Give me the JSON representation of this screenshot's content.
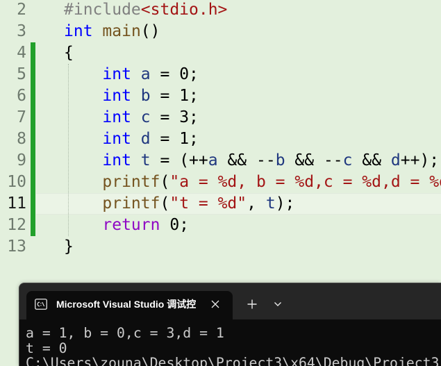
{
  "editor": {
    "lines": [
      {
        "number": "2",
        "tokens": [
          {
            "text": "#include",
            "color": "#808080"
          },
          {
            "text": "<stdio.h>",
            "color": "#a31515"
          }
        ]
      },
      {
        "number": "3",
        "tokens": [
          {
            "text": "int",
            "color": "#0000ff"
          },
          {
            "text": " ",
            "color": "#000000"
          },
          {
            "text": "main",
            "color": "#74531f"
          },
          {
            "text": "()",
            "color": "#000000"
          }
        ]
      },
      {
        "number": "4",
        "tokens": [
          {
            "text": "{",
            "color": "#000000"
          }
        ]
      },
      {
        "number": "5",
        "tokens": [
          {
            "text": "    ",
            "color": "#000000"
          },
          {
            "text": "int",
            "color": "#0000ff"
          },
          {
            "text": " ",
            "color": "#000000"
          },
          {
            "text": "a",
            "color": "#1f377f"
          },
          {
            "text": " = 0;",
            "color": "#000000"
          }
        ]
      },
      {
        "number": "6",
        "tokens": [
          {
            "text": "    ",
            "color": "#000000"
          },
          {
            "text": "int",
            "color": "#0000ff"
          },
          {
            "text": " ",
            "color": "#000000"
          },
          {
            "text": "b",
            "color": "#1f377f"
          },
          {
            "text": " = 1;",
            "color": "#000000"
          }
        ]
      },
      {
        "number": "7",
        "tokens": [
          {
            "text": "    ",
            "color": "#000000"
          },
          {
            "text": "int",
            "color": "#0000ff"
          },
          {
            "text": " ",
            "color": "#000000"
          },
          {
            "text": "c",
            "color": "#1f377f"
          },
          {
            "text": " = 3;",
            "color": "#000000"
          }
        ]
      },
      {
        "number": "8",
        "tokens": [
          {
            "text": "    ",
            "color": "#000000"
          },
          {
            "text": "int",
            "color": "#0000ff"
          },
          {
            "text": " ",
            "color": "#000000"
          },
          {
            "text": "d",
            "color": "#1f377f"
          },
          {
            "text": " = 1;",
            "color": "#000000"
          }
        ]
      },
      {
        "number": "9",
        "tokens": [
          {
            "text": "    ",
            "color": "#000000"
          },
          {
            "text": "int",
            "color": "#0000ff"
          },
          {
            "text": " ",
            "color": "#000000"
          },
          {
            "text": "t",
            "color": "#1f377f"
          },
          {
            "text": " = (++",
            "color": "#000000"
          },
          {
            "text": "a",
            "color": "#1f377f"
          },
          {
            "text": " && --",
            "color": "#000000"
          },
          {
            "text": "b",
            "color": "#1f377f"
          },
          {
            "text": " && --",
            "color": "#000000"
          },
          {
            "text": "c",
            "color": "#1f377f"
          },
          {
            "text": " && ",
            "color": "#000000"
          },
          {
            "text": "d",
            "color": "#1f377f"
          },
          {
            "text": "++);",
            "color": "#000000"
          }
        ]
      },
      {
        "number": "10",
        "tokens": [
          {
            "text": "    ",
            "color": "#000000"
          },
          {
            "text": "printf",
            "color": "#74531f"
          },
          {
            "text": "(",
            "color": "#000000"
          },
          {
            "text": "\"a = %d, b = %d,c = %d,d = %d",
            "color": "#a31515"
          }
        ]
      },
      {
        "number": "11",
        "current": true,
        "tokens": [
          {
            "text": "    ",
            "color": "#000000"
          },
          {
            "text": "printf",
            "color": "#74531f"
          },
          {
            "text": "(",
            "color": "#000000"
          },
          {
            "text": "\"t = %d\"",
            "color": "#a31515"
          },
          {
            "text": ", ",
            "color": "#000000"
          },
          {
            "text": "t",
            "color": "#1f377f"
          },
          {
            "text": ");",
            "color": "#000000"
          }
        ]
      },
      {
        "number": "12",
        "tokens": [
          {
            "text": "    ",
            "color": "#000000"
          },
          {
            "text": "return",
            "color": "#8f08c4"
          },
          {
            "text": " 0;",
            "color": "#000000"
          }
        ]
      },
      {
        "number": "13",
        "tokens": [
          {
            "text": "}",
            "color": "#000000"
          }
        ]
      }
    ]
  },
  "console": {
    "tab": {
      "title": "Microsoft Visual Studio 调试控",
      "icon": "terminal-icon",
      "close_icon": "close-icon"
    },
    "new_tab_icon": "plus-icon",
    "dropdown_icon": "chevron-down-icon",
    "output": [
      "a = 1, b = 0,c = 3,d = 1",
      "t = 0",
      "C:\\Users\\zouna\\Desktop\\Project3\\x64\\Debug\\Project3"
    ]
  },
  "colors": {
    "editor_bg": "#e3f0dd",
    "change_bar": "#22a02b",
    "indent_guide": "#a9b8a6",
    "line_number": "#6e7a6e",
    "current_line_number": "#1a1a1a",
    "tab_strip": "#262626",
    "console_bg": "#0c0c0c",
    "console_text": "#cccccc"
  }
}
